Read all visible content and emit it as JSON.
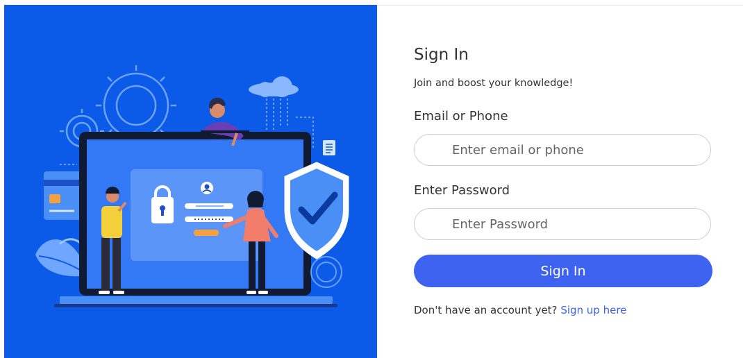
{
  "illustration": {
    "icon": "secure-login-illustration",
    "colors": {
      "background": "#0b5ae8",
      "screen": "#3378f5",
      "accent_orange": "#f5a142",
      "shield": "#4a8ff5"
    }
  },
  "form": {
    "title": "Sign In",
    "subtitle": "Join and boost your knowledge!",
    "email": {
      "label": "Email or Phone",
      "placeholder": "Enter email or phone",
      "value": ""
    },
    "password": {
      "label": "Enter Password",
      "placeholder": "Enter Password",
      "value": ""
    },
    "submit_label": "Sign In",
    "signup_prompt": "Don't have an account yet?",
    "signup_link": "Sign up here"
  },
  "colors": {
    "primary": "#3d63f0",
    "text": "#333333",
    "input_border": "#d0d0d0"
  }
}
